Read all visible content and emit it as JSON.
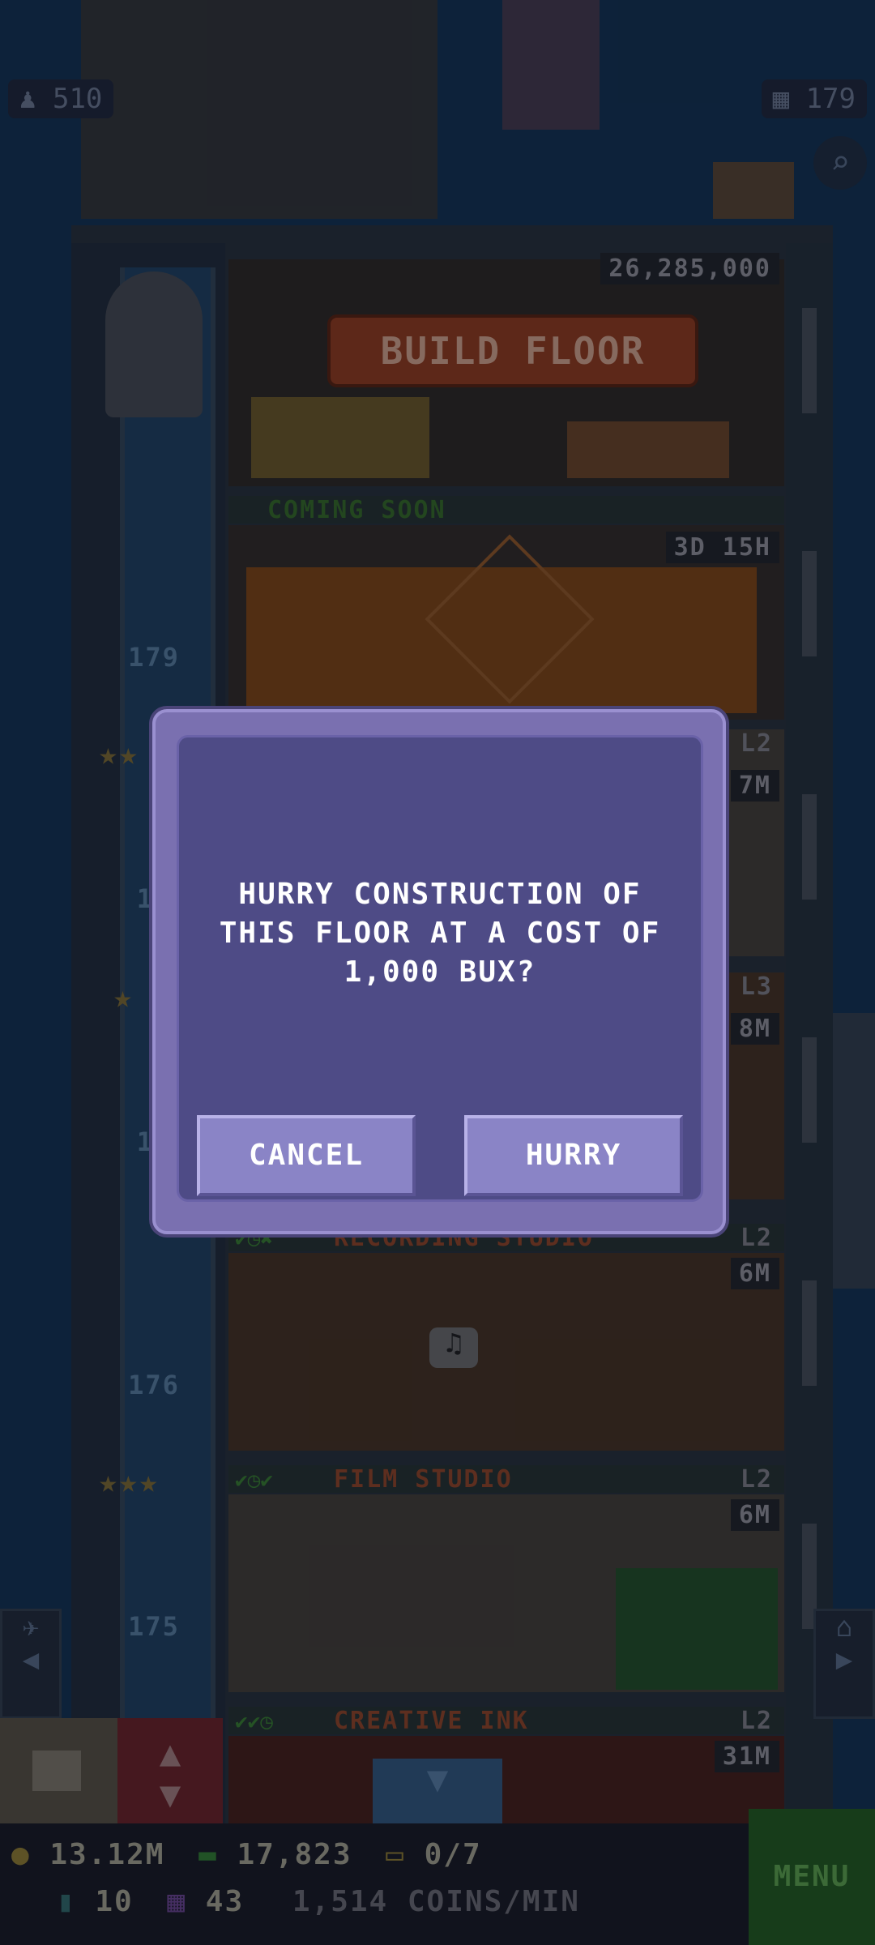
{
  "header": {
    "population": "510",
    "floors": "179"
  },
  "tower": {
    "build_floor": {
      "cost": "26,285,000",
      "button_label": "BUILD FLOOR",
      "caption": "COMING SOON"
    },
    "construction": {
      "timer": "3D 15H"
    },
    "floor_numbers": [
      "179",
      "17",
      "17",
      "176",
      "175"
    ],
    "floors": [
      {
        "name": "",
        "level": "L2",
        "value": "7M"
      },
      {
        "name": "",
        "level": "L3",
        "value": "8M"
      },
      {
        "name": "RECORDING STUDIO",
        "level": "L2",
        "value": "6M",
        "checks": "✔◷✖"
      },
      {
        "name": "FILM STUDIO",
        "level": "L2",
        "value": "6M",
        "checks": "✔◷✔"
      },
      {
        "name": "CREATIVE INK",
        "level": "L2",
        "value": "31M",
        "checks": "✔✔◷"
      }
    ]
  },
  "dialog": {
    "message_line1": "HURRY CONSTRUCTION OF",
    "message_line2": "THIS FLOOR AT A COST OF",
    "message_line3": "1,000 BUX?",
    "cancel_label": "CANCEL",
    "hurry_label": "HURRY"
  },
  "bottom_bar": {
    "coins": "13.12M",
    "bux": "17,823",
    "tickets": "0/7",
    "keys": "10",
    "items": "43",
    "rate": "1,514 COINS/MIN",
    "menu_label": "MENU"
  }
}
